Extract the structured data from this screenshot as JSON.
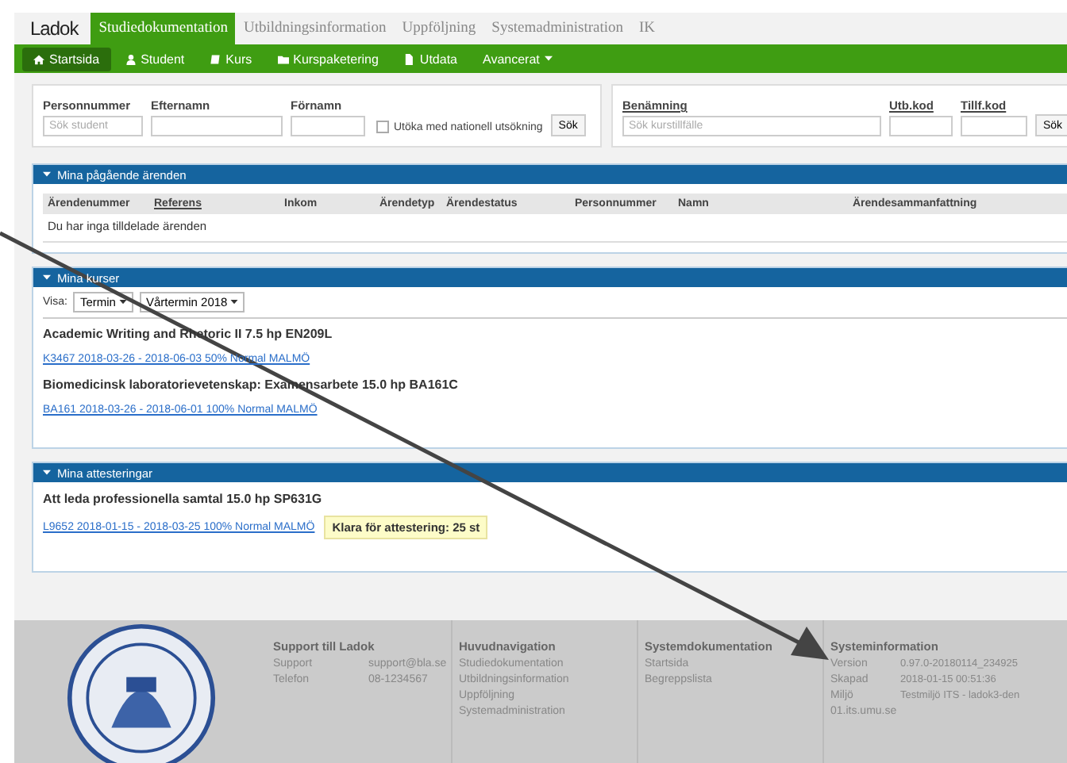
{
  "app": {
    "logo": "Ladok",
    "tabs": [
      {
        "label": "Studiedokumentation",
        "selected": true
      },
      {
        "label": "Utbildningsinformation",
        "selected": false
      },
      {
        "label": "Uppföljning",
        "selected": false
      },
      {
        "label": "Systemadministration",
        "selected": false
      },
      {
        "label": "IK",
        "selected": false
      }
    ]
  },
  "subnav": [
    {
      "label": "Startsida",
      "kind": "home",
      "selected": true
    },
    {
      "label": "Student",
      "kind": "user",
      "selected": false
    },
    {
      "label": "Kurs",
      "kind": "book",
      "selected": false
    },
    {
      "label": "Kurspaketering",
      "kind": "folder",
      "selected": false
    },
    {
      "label": "Utdata",
      "kind": "file",
      "selected": false
    },
    {
      "label": "Avancerat",
      "kind": "menu",
      "selected": false
    }
  ],
  "student_search": {
    "fields": [
      {
        "label": "Personnummer",
        "placeholder": "Sök student"
      },
      {
        "label": "Efternamn"
      },
      {
        "label": "Förnamn"
      }
    ],
    "checkbox": {
      "label": "Utöka med nationell utsökning",
      "checked": false
    },
    "button": "Sök"
  },
  "course_search": {
    "fields": [
      {
        "label": "Benämning",
        "placeholder": "Sök kurstillfälle"
      },
      {
        "label": "Utb.kod"
      },
      {
        "label": "Tillf.kod"
      }
    ],
    "button": "Sök"
  },
  "errands": {
    "title": "Mina pågående ärenden",
    "columns": [
      "Ärendenummer",
      "Referens",
      "Inkom",
      "Ärendetyp",
      "Ärendestatus",
      "Personnummer",
      "Namn",
      "Ärendesammanfattning"
    ],
    "empty": "Du har inga tilldelade ärenden"
  },
  "courses": {
    "title": "Mina kurser",
    "filter_label": "Visa:",
    "dropdowns": [
      "Termin",
      "Vårtermin 2018"
    ],
    "items": [
      {
        "title": "Academic Writing and Rhetoric II 7.5 hp EN209L",
        "link": "K3467 2018-03-26 - 2018-06-03 50% Normal MALMÖ"
      },
      {
        "title": "Biomedicinsk laboratorievetenskap: Examensarbete 15.0 hp BA161C",
        "link": "BA161 2018-03-26 - 2018-06-01 100% Normal MALMÖ"
      }
    ]
  },
  "attestations": {
    "title": "Mina attesteringar",
    "items": [
      {
        "title": "Att leda professionella samtal 15.0 hp SP631G",
        "link": "L9652 2018-01-15 - 2018-03-25 100% Normal MALMÖ",
        "badge": "Klara för attestering: 25 st"
      }
    ]
  },
  "footer": {
    "support": {
      "title": "Support till Ladok",
      "rows": [
        {
          "label": "Support",
          "value": "support@bla.se"
        },
        {
          "label": "Telefon",
          "value": "08-1234567"
        }
      ]
    },
    "navigation": {
      "title": "Huvudnavigation",
      "links": [
        "Studiedokumentation",
        "Utbildningsinformation",
        "Uppföljning",
        "Systemadministration"
      ]
    },
    "documentation": {
      "title": "Systemdokumentation",
      "links": [
        "Startsida",
        "Begreppslista"
      ]
    },
    "system_info": {
      "title": "Systeminformation",
      "rows": [
        {
          "label": "Version",
          "value": "0.97.0-20180114_234925"
        },
        {
          "label": "Skapad",
          "value": "2018-01-15 00:51:36"
        },
        {
          "label": "Miljö",
          "value": "Testmiljö ITS - ladok3-den"
        }
      ],
      "extra": "01.its.umu.se"
    }
  }
}
